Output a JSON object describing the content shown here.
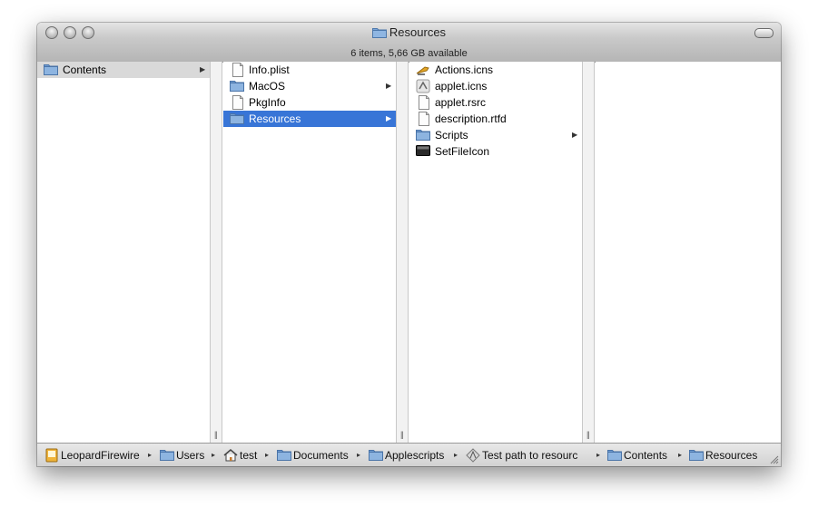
{
  "window": {
    "title": "Resources"
  },
  "status": {
    "text": "6 items, 5,66 GB available"
  },
  "columns": [
    {
      "items": [
        {
          "label": "Contents",
          "icon": "folder-icon",
          "has_children": true,
          "selected": "inactive"
        }
      ]
    },
    {
      "items": [
        {
          "label": "Info.plist",
          "icon": "document-icon",
          "has_children": false
        },
        {
          "label": "MacOS",
          "icon": "folder-icon",
          "has_children": true
        },
        {
          "label": "PkgInfo",
          "icon": "document-icon",
          "has_children": false
        },
        {
          "label": "Resources",
          "icon": "folder-icon",
          "has_children": true,
          "selected": "active"
        }
      ]
    },
    {
      "items": [
        {
          "label": "Actions.icns",
          "icon": "actions-icon",
          "has_children": false
        },
        {
          "label": "applet.icns",
          "icon": "applet-icon",
          "has_children": false
        },
        {
          "label": "applet.rsrc",
          "icon": "document-icon",
          "has_children": false
        },
        {
          "label": "description.rtfd",
          "icon": "rtfd-icon",
          "has_children": false
        },
        {
          "label": "Scripts",
          "icon": "folder-icon",
          "has_children": true
        },
        {
          "label": "SetFileIcon",
          "icon": "terminal-icon",
          "has_children": false
        }
      ]
    },
    {
      "items": []
    }
  ],
  "pathbar": [
    {
      "label": "LeopardFirewire",
      "icon": "disk-icon"
    },
    {
      "label": "Users",
      "icon": "users-folder-icon"
    },
    {
      "label": "test",
      "icon": "home-icon"
    },
    {
      "label": "Documents",
      "icon": "folder-icon"
    },
    {
      "label": "Applescripts",
      "icon": "folder-icon"
    },
    {
      "label": "Test path to resourc",
      "icon": "app-icon"
    },
    {
      "label": "Contents",
      "icon": "folder-icon"
    },
    {
      "label": "Resources",
      "icon": "folder-icon"
    }
  ],
  "colors": {
    "selection_active": "#3875d7",
    "selection_inactive": "#d9d9d9",
    "folder": "#7da7d9"
  }
}
